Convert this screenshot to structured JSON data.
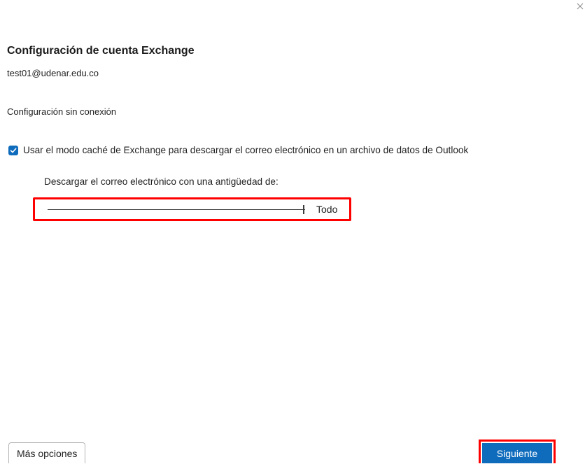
{
  "window": {
    "close_icon": "close-icon"
  },
  "header": {
    "title": "Configuración de cuenta Exchange",
    "email": "test01@udenar.edu.co"
  },
  "offline": {
    "section_label": "Configuración sin conexión",
    "cached_mode": {
      "checked": true,
      "label": "Usar el modo caché de Exchange para descargar el correo electrónico en un archivo de datos de Outlook"
    },
    "download_label": "Descargar el correo electrónico con una antigüedad de:",
    "slider": {
      "value_label": "Todo",
      "level": 1.0
    }
  },
  "footer": {
    "more_options_label": "Más opciones",
    "next_label": "Siguiente"
  },
  "colors": {
    "accent": "#0f6cbd",
    "highlight": "#ff0000"
  }
}
